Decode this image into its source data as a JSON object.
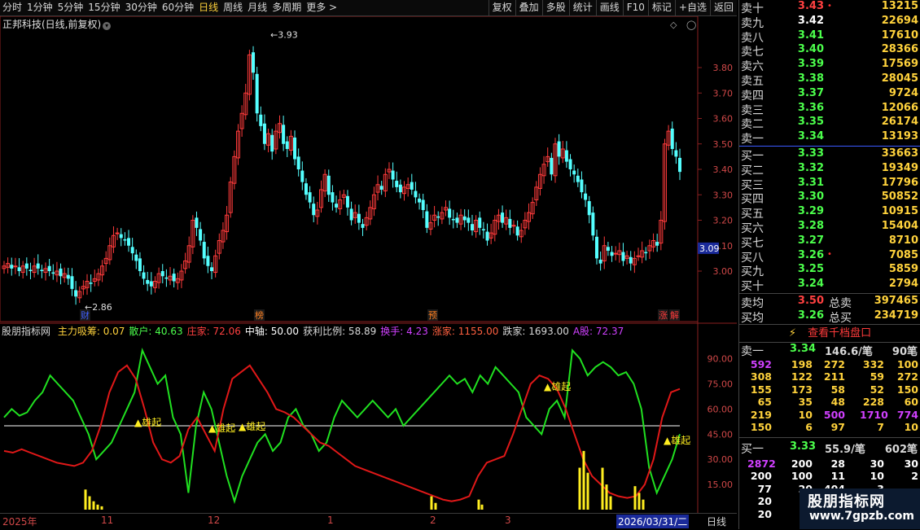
{
  "toolbar": {
    "timeframes": [
      "分时",
      "1分钟",
      "5分钟",
      "15分钟",
      "30分钟",
      "60分钟",
      "日线",
      "周线",
      "月线",
      "多周期",
      "更多 >"
    ],
    "active_timeframe": "日线",
    "actions": [
      "复权",
      "叠加",
      "多股",
      "统计",
      "画线",
      "F10",
      "标记",
      "+自选",
      "返回"
    ]
  },
  "stock": {
    "title": "正邦科技(日线,前复权)"
  },
  "main_chart": {
    "y_labels": [
      "3.80",
      "3.70",
      "3.60",
      "3.50",
      "3.40",
      "3.30",
      "3.20",
      "3.10",
      "3.00"
    ],
    "current_price_tag": "3.09",
    "high_annotation": "3.93",
    "low_annotation": "2.86",
    "event_tags": [
      "财",
      "榜",
      "预",
      "涨",
      "解"
    ]
  },
  "indicator": {
    "name": "股朋指标网",
    "items": [
      {
        "label": "主力吸筹: 0.07",
        "color": "#ffd23c"
      },
      {
        "label": "散户: 40.63",
        "color": "#4cff4c"
      },
      {
        "label": "庄家: 72.06",
        "color": "#ff4040"
      },
      {
        "label": "中轴: 50.00",
        "color": "#ffffff"
      },
      {
        "label": "获利比例: 58.89",
        "color": "#d8d8d8"
      },
      {
        "label": "换手: 4.23",
        "color": "#d040ff"
      },
      {
        "label": "涨家: 1155.00",
        "color": "#ff6040"
      },
      {
        "label": "跌家: 1693.00",
        "color": "#d8d8d8"
      },
      {
        "label": "A股: 72.37",
        "color": "#d040ff"
      }
    ],
    "y_labels": [
      "90.00",
      "75.00",
      "60.00",
      "45.00",
      "30.00",
      "15.00"
    ],
    "signal_label": "▲雄起"
  },
  "date_axis": [
    "2025年",
    "11",
    "12",
    "1",
    "2",
    "3"
  ],
  "date_cursor": "2026/03/31/二",
  "period_label": "日线",
  "orderbook": {
    "asks": [
      {
        "label": "卖十",
        "price": "3.43",
        "vol": "13215",
        "color": "rd"
      },
      {
        "label": "卖九",
        "price": "3.42",
        "vol": "22694",
        "color": "wt"
      },
      {
        "label": "卖八",
        "price": "3.41",
        "vol": "17610",
        "color": "gt"
      },
      {
        "label": "卖七",
        "price": "3.40",
        "vol": "28366",
        "color": "gt"
      },
      {
        "label": "卖六",
        "price": "3.39",
        "vol": "17569",
        "color": "gt"
      },
      {
        "label": "卖五",
        "price": "3.38",
        "vol": "28045",
        "color": "gt"
      },
      {
        "label": "卖四",
        "price": "3.37",
        "vol": "9724",
        "color": "gt"
      },
      {
        "label": "卖三",
        "price": "3.36",
        "vol": "12066",
        "color": "gt"
      },
      {
        "label": "卖二",
        "price": "3.35",
        "vol": "26174",
        "color": "gt"
      },
      {
        "label": "卖一",
        "price": "3.34",
        "vol": "13193",
        "color": "gt"
      }
    ],
    "bids": [
      {
        "label": "买一",
        "price": "3.33",
        "vol": "33663",
        "color": "gt"
      },
      {
        "label": "买二",
        "price": "3.32",
        "vol": "19349",
        "color": "gt"
      },
      {
        "label": "买三",
        "price": "3.31",
        "vol": "17796",
        "color": "gt"
      },
      {
        "label": "买四",
        "price": "3.30",
        "vol": "50852",
        "color": "gt"
      },
      {
        "label": "买五",
        "price": "3.29",
        "vol": "10915",
        "color": "gt"
      },
      {
        "label": "买六",
        "price": "3.28",
        "vol": "15404",
        "color": "gt"
      },
      {
        "label": "买七",
        "price": "3.27",
        "vol": "8710",
        "color": "gt"
      },
      {
        "label": "买八",
        "price": "3.26",
        "vol": "7085",
        "color": "gt"
      },
      {
        "label": "买九",
        "price": "3.25",
        "vol": "5859",
        "color": "gt"
      },
      {
        "label": "买十",
        "price": "3.24",
        "vol": "2794",
        "color": "gt"
      }
    ],
    "avg_sell": {
      "label": "卖均",
      "price": "3.50",
      "total_label": "总卖",
      "total": "397465"
    },
    "avg_buy": {
      "label": "买均",
      "price": "3.26",
      "total_label": "总买",
      "total": "234719"
    },
    "view_qiandang": "查看千档盘口"
  },
  "queue": {
    "sell1": {
      "label": "卖一",
      "price": "3.34",
      "per": "146.6/笔",
      "count": "90笔"
    },
    "sell_rows": [
      [
        "592",
        "198",
        "272",
        "332",
        "100"
      ],
      [
        "308",
        "122",
        "211",
        "59",
        "272"
      ],
      [
        "155",
        "173",
        "58",
        "52",
        "150"
      ],
      [
        "65",
        "35",
        "48",
        "228",
        "60"
      ],
      [
        "219",
        "10",
        "500",
        "1710",
        "774"
      ],
      [
        "150",
        "6",
        "97",
        "7",
        "10"
      ]
    ],
    "buy1": {
      "label": "买一",
      "price": "3.33",
      "per": "55.9/笔",
      "count": "602笔"
    },
    "buy_rows": [
      [
        "2872",
        "200",
        "28",
        "30",
        "30"
      ],
      [
        "200",
        "100",
        "11",
        "10",
        "2"
      ],
      [
        "77",
        "20",
        "404",
        "3",
        ""
      ],
      [
        "20",
        "",
        "",
        "",
        ""
      ],
      [
        "20",
        "",
        "",
        "",
        ""
      ]
    ]
  },
  "watermark": {
    "title": "股朋指标网",
    "url": "www.7gpzb.com"
  }
}
